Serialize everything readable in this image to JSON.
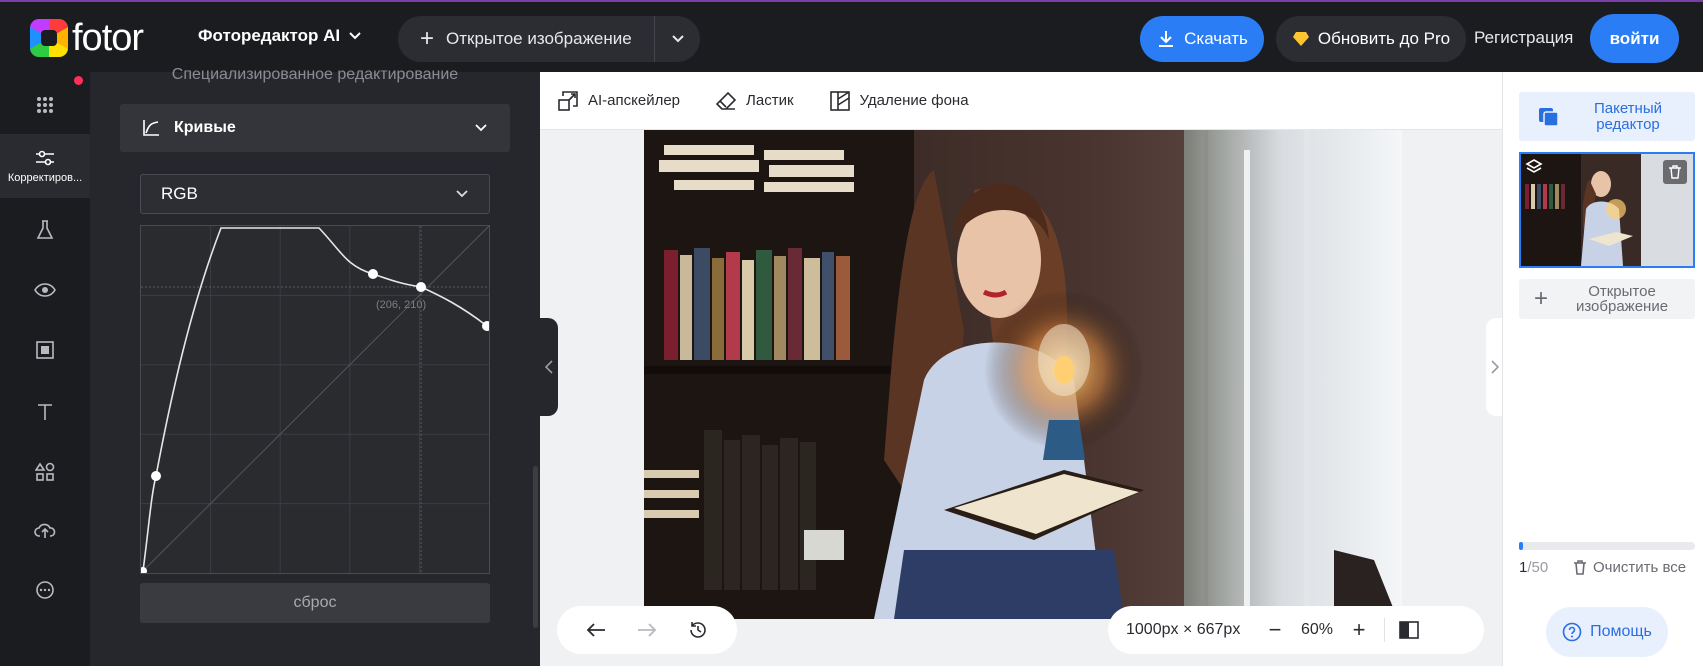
{
  "header": {
    "logo_text": "fotor",
    "editor_menu": "Фоторедактор AI",
    "open_image": "Открытое изображение",
    "download": "Скачать",
    "upgrade": "Обновить до Pro",
    "register": "Регистрация",
    "login": "войти",
    "accent_color": "#2a7df5"
  },
  "leftnav": {
    "items": [
      {
        "icon": "apps-grid-icon"
      },
      {
        "icon": "adjust-sliders-icon",
        "label": "Корректиров..."
      },
      {
        "icon": "flask-effects-icon"
      },
      {
        "icon": "eye-beauty-icon"
      },
      {
        "icon": "frame-icon"
      },
      {
        "icon": "text-icon"
      },
      {
        "icon": "elements-icon"
      },
      {
        "icon": "cloud-upload-icon"
      },
      {
        "icon": "more-icon"
      }
    ]
  },
  "panel": {
    "subtitle": "Специализированное редактирование",
    "curves_title": "Кривые",
    "channel": "RGB",
    "point_readout": "(206, 210)",
    "reset": "сброс"
  },
  "toolbar": {
    "upscaler": "AI-апскейлер",
    "eraser": "Ластик",
    "bg_remove": "Удаление фона"
  },
  "bottom": {
    "dimensions": "1000px × 667px",
    "zoom": "60%"
  },
  "sidebar": {
    "batch_editor": "Пакетный редактор",
    "open_image": "Открытое изображение",
    "count_current": "1",
    "count_total": "/50",
    "progress": 0.02,
    "clear_all": "Очистить все",
    "help": "Помощь"
  }
}
